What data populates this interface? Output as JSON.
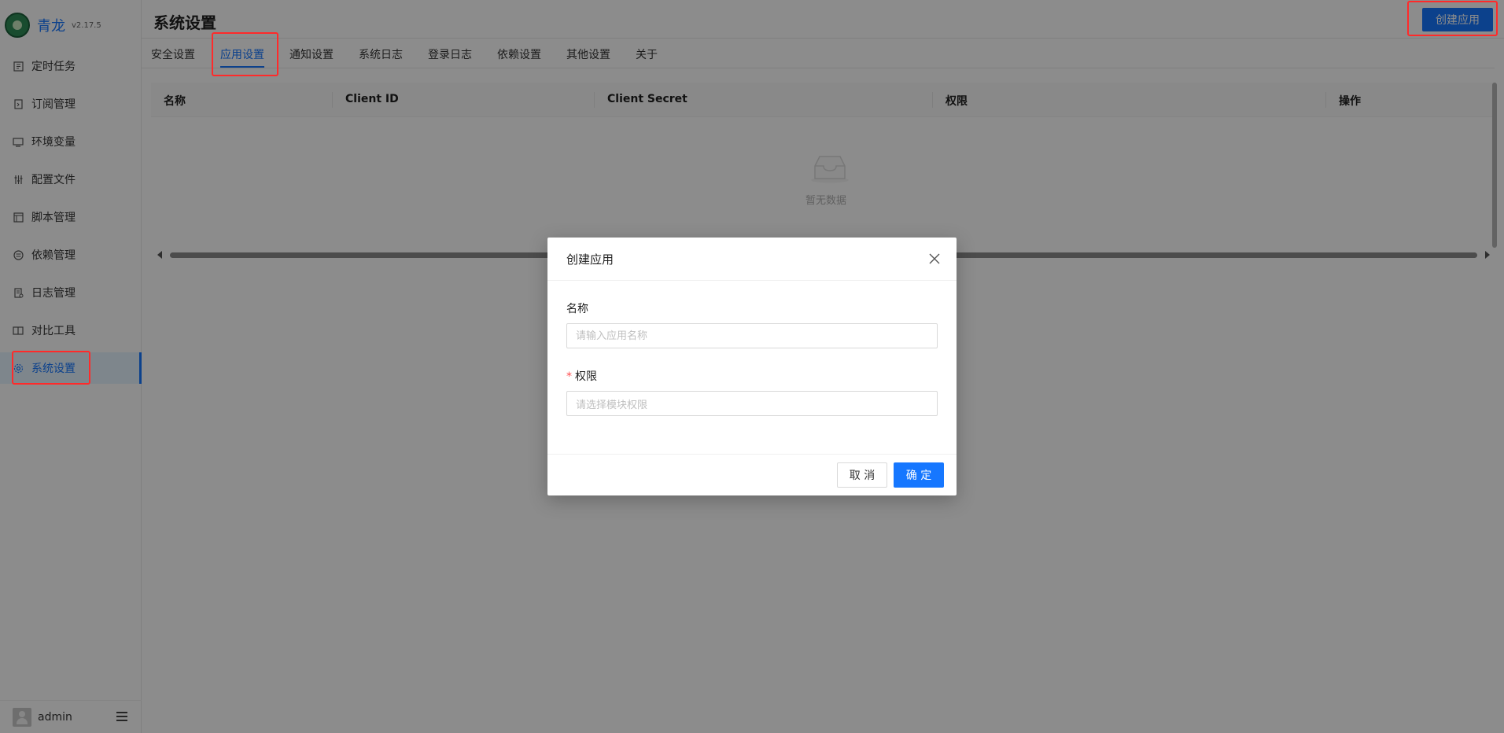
{
  "app": {
    "name": "青龙",
    "version": "v2.17.5"
  },
  "sidebar": {
    "items": [
      {
        "label": "定时任务",
        "icon": "clock-icon"
      },
      {
        "label": "订阅管理",
        "icon": "subscription-icon"
      },
      {
        "label": "环境变量",
        "icon": "monitor-icon"
      },
      {
        "label": "配置文件",
        "icon": "sliders-icon"
      },
      {
        "label": "脚本管理",
        "icon": "script-icon"
      },
      {
        "label": "依赖管理",
        "icon": "package-icon"
      },
      {
        "label": "日志管理",
        "icon": "log-icon"
      },
      {
        "label": "对比工具",
        "icon": "diff-icon"
      },
      {
        "label": "系统设置",
        "icon": "gear-icon",
        "active": true
      }
    ],
    "user": "admin"
  },
  "header": {
    "title": "系统设置",
    "create_button": "创建应用"
  },
  "tabs": [
    "安全设置",
    "应用设置",
    "通知设置",
    "系统日志",
    "登录日志",
    "依赖设置",
    "其他设置",
    "关于"
  ],
  "active_tab": "应用设置",
  "table": {
    "columns": [
      "名称",
      "Client ID",
      "Client Secret",
      "权限",
      "操作"
    ],
    "empty_text": "暂无数据"
  },
  "modal": {
    "title": "创建应用",
    "name_label": "名称",
    "name_placeholder": "请输入应用名称",
    "scope_label": "权限",
    "scope_required_mark": "*",
    "scope_placeholder": "请选择模块权限",
    "cancel_label": "取 消",
    "ok_label": "确 定"
  },
  "colors": {
    "primary": "#1677ff",
    "highlight": "#ff2a2a"
  }
}
